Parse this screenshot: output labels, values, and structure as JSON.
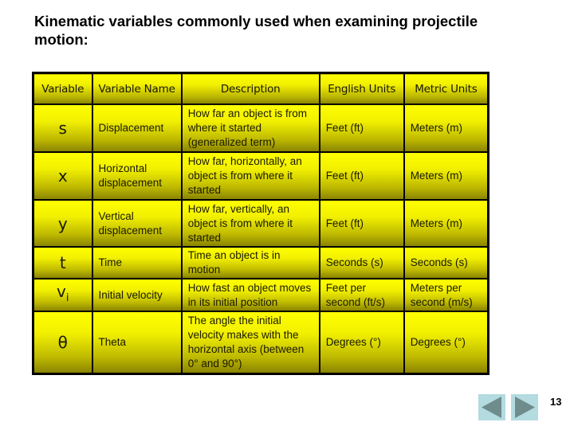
{
  "slide": {
    "title": "Kinematic variables commonly used when examining projectile motion:",
    "page_number": "13"
  },
  "table": {
    "headers": [
      "Variable",
      "Variable Name",
      "Description",
      "English Units",
      "Metric Units"
    ],
    "rows": [
      {
        "variable": "s",
        "variable_sub": "",
        "name": "Displacement",
        "description": "How far an object is from where it started (generalized term)",
        "english": "Feet (ft)",
        "metric": "Meters (m)"
      },
      {
        "variable": "x",
        "variable_sub": "",
        "name": "Horizontal displacement",
        "description": "How far, horizontally, an object is from where it started",
        "english": "Feet (ft)",
        "metric": "Meters (m)"
      },
      {
        "variable": "y",
        "variable_sub": "",
        "name": "Vertical displacement",
        "description": "How far, vertically, an object is from where it started",
        "english": "Feet (ft)",
        "metric": "Meters (m)"
      },
      {
        "variable": "t",
        "variable_sub": "",
        "name": "Time",
        "description": "Time an object is in motion",
        "english": "Seconds (s)",
        "metric": "Seconds (s)"
      },
      {
        "variable": "v",
        "variable_sub": "i",
        "name": "Initial velocity",
        "description": "How fast an object moves in its initial position",
        "english": "Feet per second (ft/s)",
        "metric": "Meters per second (m/s)"
      },
      {
        "variable": "θ",
        "variable_sub": "",
        "name": "Theta",
        "description": "The angle the initial velocity makes with the horizontal axis (between 0° and 90°)",
        "english": "Degrees (°)",
        "metric": "Degrees (°)"
      }
    ]
  },
  "navigation": {
    "prev_icon": "triangle-left-icon",
    "next_icon": "triangle-right-icon"
  },
  "colors": {
    "cell_top": "#ffff00",
    "cell_bottom": "#8a8400",
    "nav_bg": "#b3dbe0",
    "nav_arrow": "#6f8c8c"
  }
}
